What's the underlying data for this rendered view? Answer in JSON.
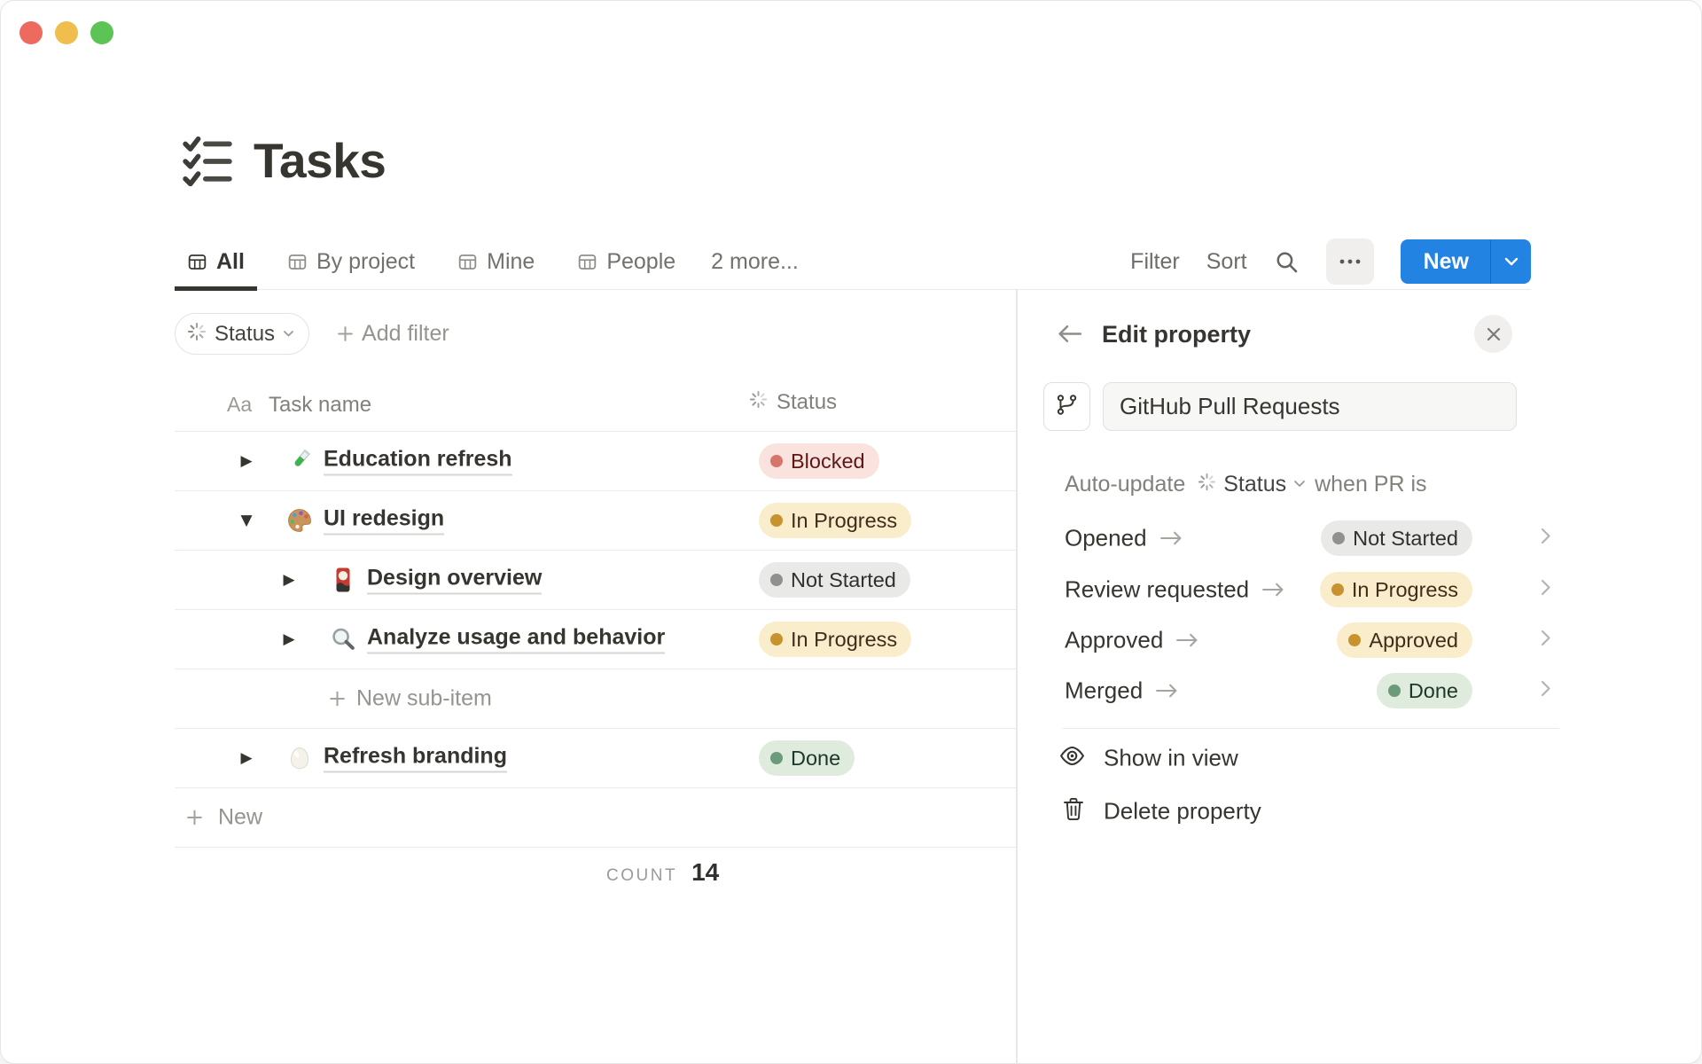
{
  "window": {
    "traffic_lights": {
      "close": "#EC6A5E",
      "minimize": "#F0BE4D",
      "zoom": "#5BC454"
    }
  },
  "page": {
    "title": "Tasks",
    "icon": "checklist-icon"
  },
  "toolbar": {
    "tabs": [
      {
        "label": "All",
        "icon": "table-icon",
        "active": true
      },
      {
        "label": "By project",
        "icon": "table-icon",
        "active": false
      },
      {
        "label": "Mine",
        "icon": "table-icon",
        "active": false
      },
      {
        "label": "People",
        "icon": "table-icon",
        "active": false
      }
    ],
    "more_tabs_label": "2 more...",
    "filter_label": "Filter",
    "sort_label": "Sort",
    "new_button_label": "New"
  },
  "filter_bar": {
    "status_chip_label": "Status",
    "add_filter_label": "Add filter"
  },
  "table": {
    "columns": {
      "name_column": {
        "icon_label": "Aa",
        "label": "Task name"
      },
      "status_column": {
        "icon": "status-spinner-icon",
        "label": "Status"
      }
    },
    "rows": [
      {
        "level": 0,
        "toggle": "collapsed",
        "icon": "test-tube-icon",
        "name": "Education refresh",
        "status": {
          "label": "Blocked",
          "color": "red"
        }
      },
      {
        "level": 0,
        "toggle": "expanded",
        "icon": "palette-icon",
        "name": "UI redesign",
        "status": {
          "label": "In Progress",
          "color": "yellow"
        }
      },
      {
        "level": 1,
        "toggle": "collapsed",
        "icon": "flower-card-icon",
        "name": "Design overview",
        "status": {
          "label": "Not Started",
          "color": "gray"
        }
      },
      {
        "level": 1,
        "toggle": "collapsed",
        "icon": "magnifier-icon",
        "name": "Analyze usage and behavior",
        "status": {
          "label": "In Progress",
          "color": "yellow"
        }
      },
      {
        "level": 0,
        "toggle": "collapsed",
        "icon": "egg-icon",
        "name": "Refresh branding",
        "status": {
          "label": "Done",
          "color": "green"
        }
      }
    ],
    "new_sub_item_label": "New sub-item",
    "new_row_label": "New",
    "count_label": "COUNT",
    "count_value": "14"
  },
  "panel": {
    "title": "Edit property",
    "property_icon": "git-branch-icon",
    "property_name": "GitHub Pull Requests",
    "auto_update": {
      "prefix": "Auto-update",
      "property": "Status",
      "suffix": "when PR is"
    },
    "mappings": [
      {
        "event": "Opened",
        "status": {
          "label": "Not Started",
          "color": "gray"
        }
      },
      {
        "event": "Review requested",
        "status": {
          "label": "In Progress",
          "color": "yellow"
        }
      },
      {
        "event": "Approved",
        "status": {
          "label": "Approved",
          "color": "yellow"
        }
      },
      {
        "event": "Merged",
        "status": {
          "label": "Done",
          "color": "green"
        }
      }
    ],
    "actions": [
      {
        "icon": "eye-icon",
        "label": "Show in view"
      },
      {
        "icon": "trash-icon",
        "label": "Delete property"
      }
    ]
  },
  "colors": {
    "accent_blue": "#2383E2",
    "text_dark": "#37352F",
    "text_gray": "#787774",
    "divider": "#E9E9E7",
    "pill_red_bg": "#FAE2DF",
    "pill_red_dot": "#D6756B",
    "pill_red_text": "#5D1715",
    "pill_yellow_bg": "#FAEDCB",
    "pill_yellow_dot": "#C8922E",
    "pill_yellow_text": "#402C1B",
    "pill_gray_bg": "#E9E9E7",
    "pill_gray_dot": "#90908C",
    "pill_gray_text": "#32302C",
    "pill_green_bg": "#DFEBDD",
    "pill_green_dot": "#6C9B7C",
    "pill_green_text": "#1C3829"
  }
}
